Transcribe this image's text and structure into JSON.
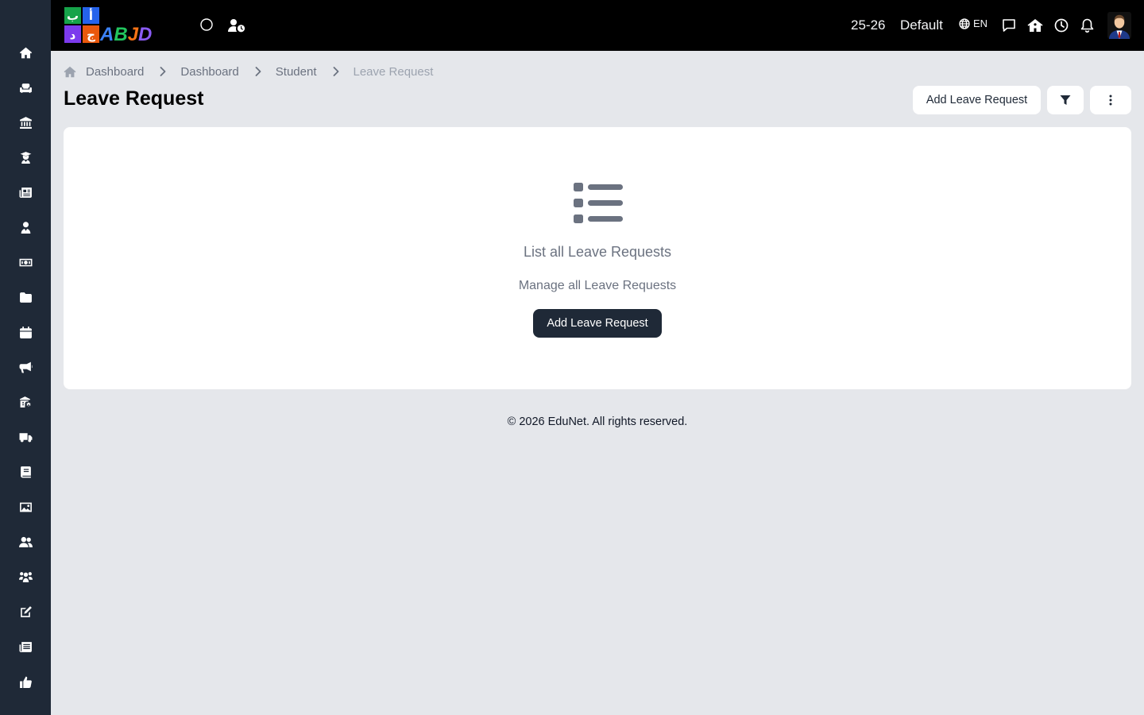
{
  "brand": {
    "logo_label": "ABJD"
  },
  "sidebar": {
    "items": [
      {
        "name": "home",
        "icon": "home-icon"
      },
      {
        "name": "classes",
        "icon": "couch-icon"
      },
      {
        "name": "institution",
        "icon": "bank-icon"
      },
      {
        "name": "teachers",
        "icon": "teacher-icon"
      },
      {
        "name": "courses",
        "icon": "newspaper-icon"
      },
      {
        "name": "students",
        "icon": "user-tie-icon"
      },
      {
        "name": "fees",
        "icon": "money-icon"
      },
      {
        "name": "files",
        "icon": "folder-icon"
      },
      {
        "name": "calendar",
        "icon": "calendar-icon"
      },
      {
        "name": "announcements",
        "icon": "megaphone-icon"
      },
      {
        "name": "school-settings",
        "icon": "school-gear-icon"
      },
      {
        "name": "transport",
        "icon": "truck-icon"
      },
      {
        "name": "library",
        "icon": "book-icon"
      },
      {
        "name": "gallery",
        "icon": "image-icon"
      },
      {
        "name": "users",
        "icon": "users-icon"
      },
      {
        "name": "groups",
        "icon": "people-group-icon"
      },
      {
        "name": "exams",
        "icon": "edit-icon"
      },
      {
        "name": "news",
        "icon": "newspaper-alt-icon"
      },
      {
        "name": "feedback",
        "icon": "thumbs-up-icon"
      }
    ]
  },
  "topbar": {
    "session": "25-26",
    "profile": "Default",
    "language": "EN"
  },
  "breadcrumb": [
    "Dashboard",
    "Dashboard",
    "Student",
    "Leave Request"
  ],
  "page": {
    "title": "Leave Request",
    "add_button": "Add Leave Request"
  },
  "empty_state": {
    "title": "List all Leave Requests",
    "subtitle": "Manage all Leave Requests",
    "button": "Add Leave Request"
  },
  "footer": {
    "text": "© 2026 EduNet. All rights reserved."
  }
}
